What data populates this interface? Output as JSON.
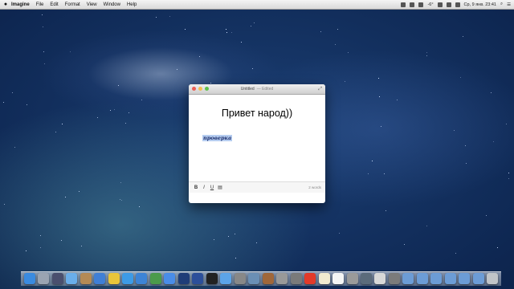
{
  "menubar": {
    "apple_icon": "apple-icon",
    "items": [
      "Imagine",
      "File",
      "Edit",
      "Format",
      "View",
      "Window",
      "Help"
    ],
    "status": {
      "temperature": "-6°",
      "clock": "Ср, 9 янв. 23:41"
    }
  },
  "window": {
    "title": "Untitled",
    "title_suffix": "— Edited",
    "heading": "Привет народ))",
    "selected_text": "проверка",
    "toolbar": {
      "bold": "B",
      "italic": "I",
      "underline": "U",
      "word_count": "2 words"
    }
  },
  "dock": {
    "icons": [
      "finder-icon",
      "launchpad-icon",
      "mission-control-icon",
      "mail-icon",
      "contacts-icon",
      "itunes-icon",
      "chrome-icon",
      "twitter-icon",
      "safari-icon",
      "facetime-icon",
      "app-store-icon",
      "photoshop-icon",
      "photoshop-alt-icon",
      "terminal-icon",
      "preview-icon",
      "screenshot-icon",
      "iphoto-icon",
      "tools-icon",
      "disk-icon",
      "quill-icon",
      "calendar-icon",
      "notes-icon",
      "textedit-icon",
      "app-icon-1",
      "app-icon-2",
      "app-icon-3",
      "system-prefs-icon",
      "folder-icon-1",
      "folder-icon-2",
      "folder-icon-3",
      "folder-icon-4",
      "folder-icon-5",
      "folder-icon-6",
      "trash-icon"
    ],
    "colors": [
      "#3a8be0",
      "#9aa4b2",
      "#4a4f6e",
      "#6aaeea",
      "#b48a55",
      "#3f7fd6",
      "#e9c53a",
      "#3d9be6",
      "#3d84d6",
      "#4b9b4b",
      "#4a8de8",
      "#1f3d78",
      "#2c4f9a",
      "#222",
      "#5ca4e8",
      "#888",
      "#6b8fb5",
      "#a0673a",
      "#999",
      "#7a7a7a",
      "#e23a2a",
      "#f0ead0",
      "#f5f5f5",
      "#9a9a9a",
      "#5b6b7b",
      "#d8d8d8",
      "#7b7b7b",
      "#6c9cd6",
      "#6c9cd6",
      "#6c9cd6",
      "#6c9cd6",
      "#6c9cd6",
      "#6c9cd6",
      "#c0c4c8"
    ]
  }
}
